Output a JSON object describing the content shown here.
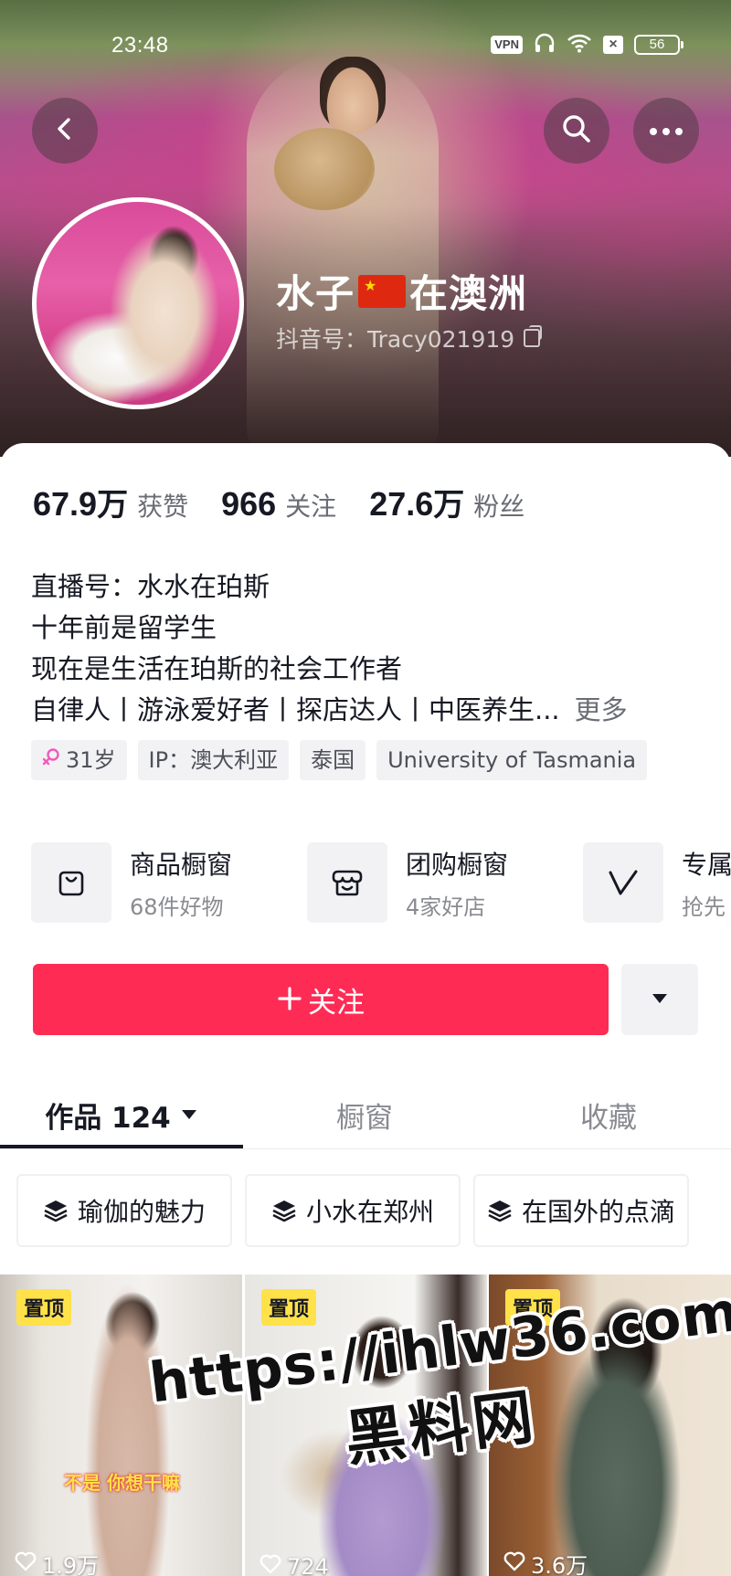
{
  "status_bar": {
    "time": "23:48",
    "vpn": "VPN",
    "battery": "56",
    "icons": [
      "vpn-icon",
      "headphones-icon",
      "wifi-icon",
      "no-sim-icon",
      "battery-icon"
    ]
  },
  "header": {
    "back_icon": "chevron-left-icon",
    "search_icon": "search-icon",
    "more_icon": "ellipsis-icon"
  },
  "profile": {
    "name_part1": "水子",
    "name_flag": "china-flag-emoji",
    "name_part2": "在澳洲",
    "douyin_id": "抖音号：Tracy021919"
  },
  "stats": [
    {
      "value": "67.9",
      "unit": "万",
      "label": "获赞"
    },
    {
      "value": "966",
      "unit": "",
      "label": "关注"
    },
    {
      "value": "27.6",
      "unit": "万",
      "label": "粉丝"
    }
  ],
  "bio": {
    "lines": [
      "直播号：水水在珀斯",
      "十年前是留学生",
      "现在是生活在珀斯的社会工作者",
      "自律人丨游泳爱好者丨探店达人丨中医养生..."
    ],
    "more": "更多"
  },
  "tags": [
    {
      "icon": "female-icon",
      "text": "31岁"
    },
    {
      "text": "IP：澳大利亚"
    },
    {
      "text": "泰国"
    },
    {
      "text": "University of Tasmania"
    }
  ],
  "services": [
    {
      "icon": "shopping-bag-icon",
      "title": "商品橱窗",
      "subtitle": "68件好物"
    },
    {
      "icon": "storefront-icon",
      "title": "团购橱窗",
      "subtitle": "4家好店"
    },
    {
      "icon": "v-badge-icon",
      "title": "专属",
      "subtitle": "抢先"
    }
  ],
  "actions": {
    "follow_label": "关注",
    "follow_icon": "plus-icon",
    "dropdown_icon": "caret-down-icon",
    "follow_color": "#fe2c55"
  },
  "tabs": [
    {
      "label": "作品 124",
      "active": true
    },
    {
      "label": "橱窗",
      "active": false
    },
    {
      "label": "收藏",
      "active": false
    }
  ],
  "collections": [
    {
      "icon": "layers-icon",
      "label": "瑜伽的魅力"
    },
    {
      "icon": "layers-icon",
      "label": "小水在郑州"
    },
    {
      "icon": "layers-icon",
      "label": "在国外的点滴"
    }
  ],
  "videos": [
    {
      "badge": "置顶",
      "likes": "1.9万",
      "caption": "不是 你想干嘛"
    },
    {
      "badge": "置顶",
      "likes": "724"
    },
    {
      "badge": "置顶",
      "likes": "3.6万"
    }
  ],
  "watermark": {
    "url": "https://ihlw36.com",
    "name": "黑料网"
  }
}
